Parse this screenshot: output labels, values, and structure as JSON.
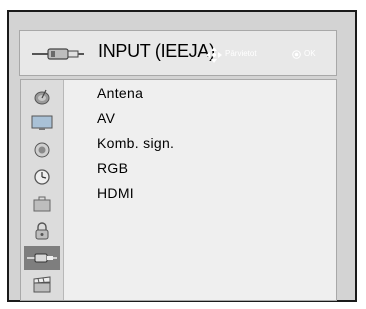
{
  "header": {
    "title": "INPUT (IEEJA)",
    "nav_label": "Pārvietot",
    "ok_label": "OK",
    "icon": "input-cable-icon"
  },
  "menu": {
    "items": [
      {
        "label": "Antena"
      },
      {
        "label": "AV"
      },
      {
        "label": "Komb. sign."
      },
      {
        "label": "RGB"
      },
      {
        "label": "HDMI"
      }
    ]
  },
  "sidebar": {
    "items": [
      {
        "icon": "satellite-dish-icon",
        "selected": false
      },
      {
        "icon": "monitor-icon",
        "selected": false
      },
      {
        "icon": "speaker-icon",
        "selected": false
      },
      {
        "icon": "clock-icon",
        "selected": false
      },
      {
        "icon": "toolbox-icon",
        "selected": false
      },
      {
        "icon": "lock-icon",
        "selected": false
      },
      {
        "icon": "input-cable-icon",
        "selected": true
      },
      {
        "icon": "clapperboard-icon",
        "selected": false
      }
    ]
  },
  "colors": {
    "frame": "#d3d3d3",
    "header_bg": "#e8e8e8",
    "selected_bg": "#7e7e7e"
  }
}
